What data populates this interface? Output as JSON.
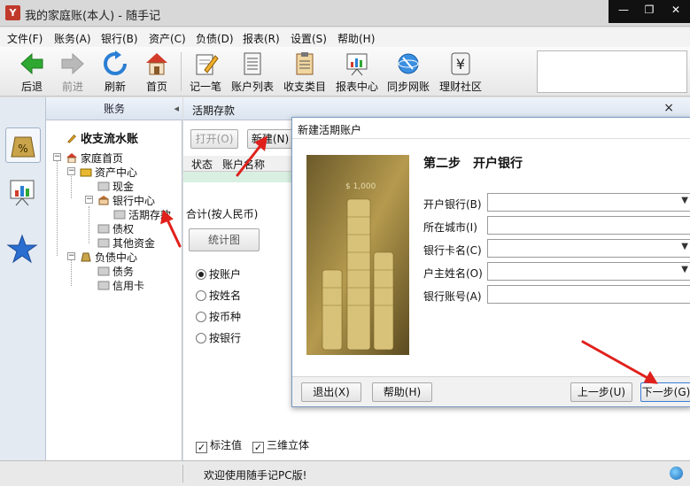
{
  "window": {
    "title": "我的家庭账(本人) - 随手记",
    "app_icon": "Y"
  },
  "menu": [
    "文件(F)",
    "账务(A)",
    "银行(B)",
    "资产(C)",
    "负债(D)",
    "报表(R)",
    "设置(S)",
    "帮助(H)"
  ],
  "toolbar": {
    "back": "后退",
    "forward": "前进",
    "refresh": "刷新",
    "home": "首页",
    "record": "记一笔",
    "account_list": "账户列表",
    "category": "收支类目",
    "report_center": "报表中心",
    "sync": "同步网账",
    "community": "理财社区"
  },
  "nav": {
    "header": "账务",
    "collapse": "◂",
    "top_link": "收支流水账",
    "tree": {
      "home": "家庭首页",
      "assets": "资产中心",
      "cash": "现金",
      "bank": "银行中心",
      "current_deposit": "活期存款",
      "claims": "债权",
      "other_funds": "其他资金",
      "liabilities": "负债中心",
      "debts": "债务",
      "credit_card": "信用卡"
    }
  },
  "main": {
    "title": "活期存款",
    "close": "×",
    "open_btn": "打开(O)",
    "new_btn": "新建(N)",
    "col_status": "状态",
    "col_account_name": "账户名称",
    "total_label": "合计(按人民币)",
    "stats_tab": "统计图",
    "group_options": [
      "按账户",
      "按姓名",
      "按币种",
      "按银行"
    ],
    "selected_option": "按账户",
    "check_values": "标注值",
    "check_3d": "三维立体",
    "check_values_on": true,
    "check_3d_on": true
  },
  "status": {
    "text": "欢迎使用随手记PC版!"
  },
  "dialog": {
    "title": "新建活期账户",
    "step": "第二步　开户银行",
    "fields": [
      {
        "label": "开户银行(B)",
        "value": "",
        "dropdown": true
      },
      {
        "label": "所在城市(I)",
        "value": "",
        "dropdown": false
      },
      {
        "label": "银行卡名(C)",
        "value": "",
        "dropdown": true
      },
      {
        "label": "户主姓名(O)",
        "value": "",
        "dropdown": true
      },
      {
        "label": "银行账号(A)",
        "value": "",
        "dropdown": false
      }
    ],
    "exit_btn": "退出(X)",
    "help_btn": "帮助(H)",
    "prev_btn": "上一步(U)",
    "next_btn": "下一步(G)",
    "banner_text": "$ 1,000"
  },
  "colors": {
    "accent_red": "#e0201b",
    "panel_blue": "#dbe4ef",
    "highlight_green": "#d9efe2"
  }
}
